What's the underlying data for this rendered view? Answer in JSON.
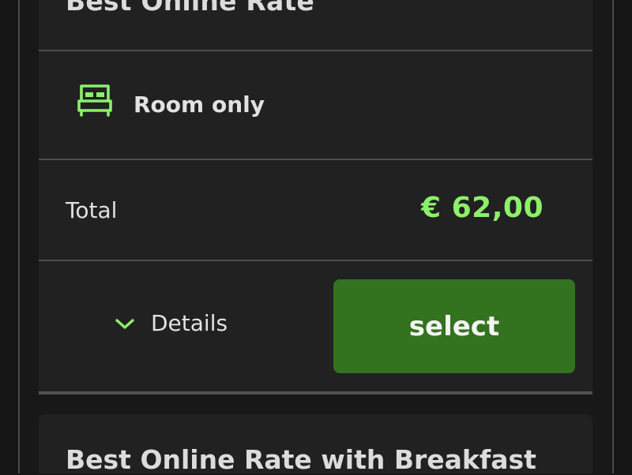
{
  "rate_cards": [
    {
      "title": "Best Online Rate",
      "meal_plan": {
        "icon": "bed-icon",
        "label": "Room only"
      },
      "total": {
        "label": "Total",
        "price": "€ 62,00"
      },
      "details_label": "Details",
      "select_label": "select"
    },
    {
      "title": "Best Online Rate with Breakfast"
    }
  ],
  "colors": {
    "accent_green": "#8cf06a",
    "button_green": "#33721f",
    "card_bg": "#212121",
    "page_bg": "#161616"
  }
}
